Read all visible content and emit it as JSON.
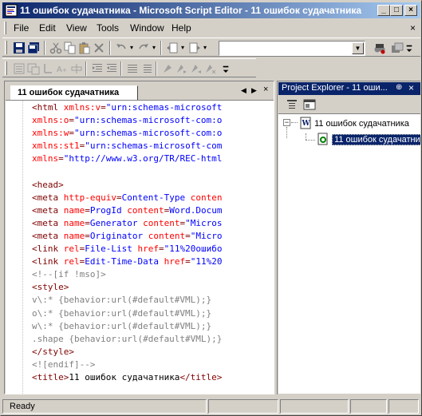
{
  "window": {
    "title": "11 ошибок судачатника - Microsoft Script Editor - 11 ошибок судачатника"
  },
  "menu": {
    "items": [
      "File",
      "Edit",
      "View",
      "Tools",
      "Window",
      "Help"
    ],
    "close_glyph": "×"
  },
  "toolbar": {
    "combo_value": ""
  },
  "editor": {
    "tab_label": "11 ошибок судачатника",
    "lines": [
      [
        [
          "c-tag",
          "<html "
        ],
        [
          "c-attr",
          "xmlns:v"
        ],
        [
          "c-tag",
          "="
        ],
        [
          "c-val",
          "\"urn:schemas-microsoft"
        ]
      ],
      [
        [
          "c-attr",
          "xmlns:o"
        ],
        [
          "c-tag",
          "="
        ],
        [
          "c-val",
          "\"urn:schemas-microsoft-com:o"
        ]
      ],
      [
        [
          "c-attr",
          "xmlns:w"
        ],
        [
          "c-tag",
          "="
        ],
        [
          "c-val",
          "\"urn:schemas-microsoft-com:o"
        ]
      ],
      [
        [
          "c-attr",
          "xmlns:st1"
        ],
        [
          "c-tag",
          "="
        ],
        [
          "c-val",
          "\"urn:schemas-microsoft-com"
        ]
      ],
      [
        [
          "c-attr",
          "xmlns"
        ],
        [
          "c-tag",
          "="
        ],
        [
          "c-val",
          "\"http://www.w3.org/TR/REC-html"
        ]
      ],
      [],
      [
        [
          "c-tag",
          "<head>"
        ]
      ],
      [
        [
          "c-tag",
          "<meta "
        ],
        [
          "c-attr",
          "http-equiv"
        ],
        [
          "c-tag",
          "="
        ],
        [
          "c-val",
          "Content-Type "
        ],
        [
          "c-attr",
          "conten"
        ]
      ],
      [
        [
          "c-tag",
          "<meta "
        ],
        [
          "c-attr",
          "name"
        ],
        [
          "c-tag",
          "="
        ],
        [
          "c-val",
          "ProgId "
        ],
        [
          "c-attr",
          "content"
        ],
        [
          "c-tag",
          "="
        ],
        [
          "c-val",
          "Word.Docum"
        ]
      ],
      [
        [
          "c-tag",
          "<meta "
        ],
        [
          "c-attr",
          "name"
        ],
        [
          "c-tag",
          "="
        ],
        [
          "c-val",
          "Generator "
        ],
        [
          "c-attr",
          "content"
        ],
        [
          "c-tag",
          "="
        ],
        [
          "c-val",
          "\"Micros"
        ]
      ],
      [
        [
          "c-tag",
          "<meta "
        ],
        [
          "c-attr",
          "name"
        ],
        [
          "c-tag",
          "="
        ],
        [
          "c-val",
          "Originator "
        ],
        [
          "c-attr",
          "content"
        ],
        [
          "c-tag",
          "="
        ],
        [
          "c-val",
          "\"Micro"
        ]
      ],
      [
        [
          "c-tag",
          "<link "
        ],
        [
          "c-attr",
          "rel"
        ],
        [
          "c-tag",
          "="
        ],
        [
          "c-val",
          "File-List "
        ],
        [
          "c-attr",
          "href"
        ],
        [
          "c-tag",
          "="
        ],
        [
          "c-val",
          "\"11%20ошибо"
        ]
      ],
      [
        [
          "c-tag",
          "<link "
        ],
        [
          "c-attr",
          "rel"
        ],
        [
          "c-tag",
          "="
        ],
        [
          "c-val",
          "Edit-Time-Data "
        ],
        [
          "c-attr",
          "href"
        ],
        [
          "c-tag",
          "="
        ],
        [
          "c-val",
          "\"11%20"
        ]
      ],
      [
        [
          "c-com",
          "<!--[if !mso]>"
        ]
      ],
      [
        [
          "c-tag",
          "<style>"
        ]
      ],
      [
        [
          "c-com",
          "v\\:* {behavior:url(#default#VML);}"
        ]
      ],
      [
        [
          "c-com",
          "o\\:* {behavior:url(#default#VML);}"
        ]
      ],
      [
        [
          "c-com",
          "w\\:* {behavior:url(#default#VML);}"
        ]
      ],
      [
        [
          "c-com",
          ".shape {behavior:url(#default#VML);}"
        ]
      ],
      [
        [
          "c-tag",
          "</style>"
        ]
      ],
      [
        [
          "c-com",
          "<![endif]-->"
        ]
      ],
      [
        [
          "c-tag",
          "<title>"
        ],
        [
          "c-txt",
          "11 ошибок судачатника"
        ],
        [
          "c-tag",
          "</title>"
        ]
      ]
    ]
  },
  "project_explorer": {
    "title": "Project Explorer - 11 оши...",
    "pin_glyph": "⊕",
    "close_glyph": "×",
    "root_label": "11 ошибок судачатника",
    "child_label": "11 ошибок судачатника",
    "expander_glyph": "−"
  },
  "status": {
    "text": "Ready"
  },
  "colors": {
    "title_active": "#0a246a",
    "tag": "#800000",
    "attr": "#ff0000",
    "value": "#0000ff",
    "comment": "#808080"
  }
}
